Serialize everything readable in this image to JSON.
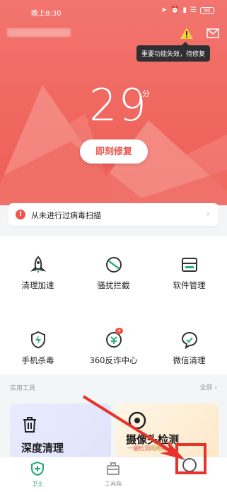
{
  "status_bar": {
    "time": "晚上8:30",
    "battery": "90"
  },
  "header": {
    "warning_tooltip": "重要功能失效，待修复"
  },
  "hero": {
    "score": "29",
    "score_unit": "分",
    "fix_button": "即刻修复"
  },
  "alert": {
    "text": "从未进行过病毒扫描",
    "icon": "!"
  },
  "tools": [
    {
      "label": "清理加速",
      "icon": "rocket-icon"
    },
    {
      "label": "骚扰拦截",
      "icon": "block-icon"
    },
    {
      "label": "软件管理",
      "icon": "software-icon"
    },
    {
      "label": "手机杀毒",
      "icon": "shield-bolt-icon"
    },
    {
      "label": "360反诈中心",
      "icon": "anti-fraud-icon"
    },
    {
      "label": "微信清理",
      "icon": "wechat-icon"
    }
  ],
  "section": {
    "title": "实用工具",
    "all": "全部"
  },
  "cards": {
    "deep_clean": {
      "title": "深度清理",
      "icon": "trash-icon"
    },
    "camera_check": {
      "title": "摄像头检测",
      "sub_highlight": "一键检测",
      "sub_rest": "网络摄"
    }
  },
  "nav": [
    {
      "label": "卫士",
      "icon": "guard-icon",
      "color": "#21a675"
    },
    {
      "label": "工具箱",
      "icon": "toolbox-icon",
      "color": "#9a9a9a"
    }
  ],
  "colors": {
    "accent": "#f0544c",
    "hero_top": "#f3756f",
    "nav_active": "#21a675"
  }
}
